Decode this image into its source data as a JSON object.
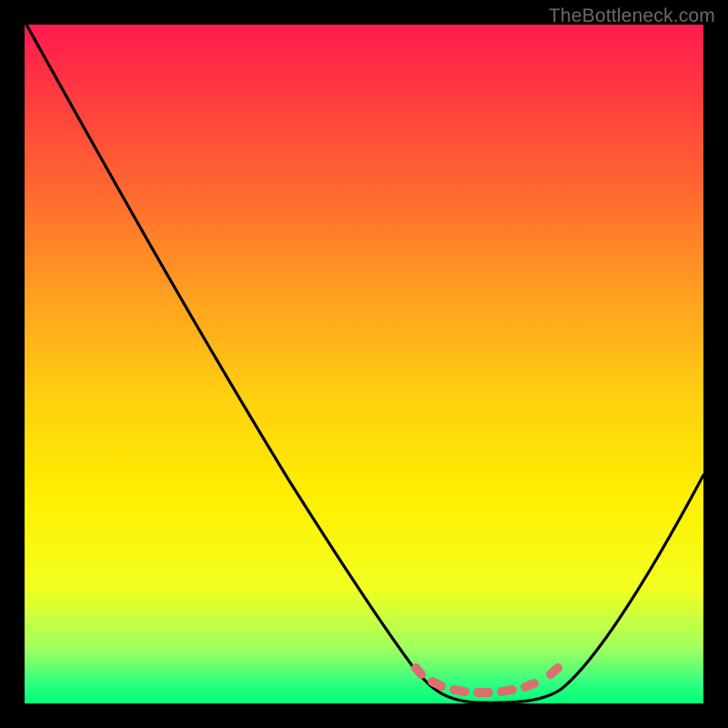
{
  "watermark": "TheBottleneck.com",
  "chart_data": {
    "type": "line",
    "title": "",
    "xlabel": "",
    "ylabel": "",
    "xlim": [
      0,
      100
    ],
    "ylim": [
      0,
      100
    ],
    "grid": false,
    "legend": false,
    "background": "red-yellow-green vertical gradient",
    "series": [
      {
        "name": "bottleneck-curve",
        "x": [
          0,
          10,
          20,
          30,
          40,
          50,
          58,
          62,
          68,
          74,
          80,
          90,
          100
        ],
        "y": [
          100,
          82,
          64,
          47,
          30,
          14,
          4,
          1,
          0,
          0,
          3,
          16,
          34
        ]
      }
    ],
    "markers": [
      {
        "name": "highlight-band",
        "shape": "dashed-segment",
        "color": "#e57373",
        "x_range": [
          58,
          80
        ],
        "y_approx": 4
      }
    ],
    "notes": "No axis tick labels present in image; values estimated on 0-100 normalized axes. Curve minimum (optimal zone) at roughly x=68-74."
  }
}
